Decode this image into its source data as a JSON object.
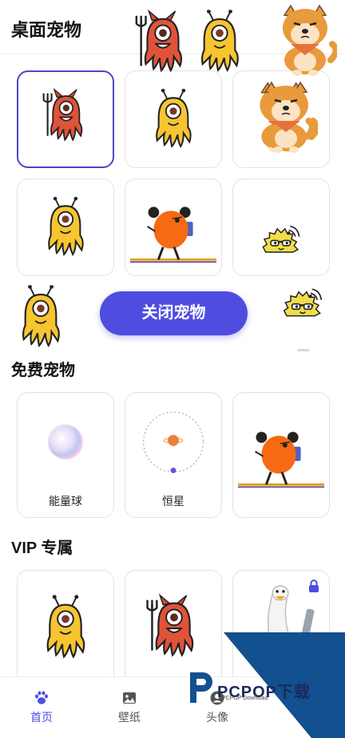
{
  "desktop_pets": {
    "title": "桌面宠物",
    "items": [
      {
        "icon": "devil-octopus",
        "selected": true
      },
      {
        "icon": "yellow-alien-octopus",
        "selected": false
      },
      {
        "icon": "shiba-dog",
        "selected": false
      },
      {
        "icon": "yellow-alien-octopus",
        "selected": false
      },
      {
        "icon": "orange-bean-runner",
        "selected": false
      },
      {
        "icon": "hedgehog-wifi",
        "selected": false
      }
    ]
  },
  "close_pet_button": {
    "label": "关闭宠物"
  },
  "free_pets": {
    "title": "免费宠物",
    "items": [
      {
        "label": "能量球",
        "icon": "energy-orb"
      },
      {
        "label": "恒星",
        "icon": "planet-orbit"
      },
      {
        "label": "",
        "icon": "orange-bean-runner"
      }
    ]
  },
  "vip": {
    "title": "VIP 专属",
    "items": [
      {
        "icon": "yellow-alien-octopus",
        "locked": false
      },
      {
        "icon": "devil-octopus",
        "locked": false
      },
      {
        "icon": "white-goose",
        "locked": true
      }
    ]
  },
  "tabbar": {
    "tabs": [
      {
        "label": "首页",
        "icon": "paw-icon",
        "active": true
      },
      {
        "label": "壁纸",
        "icon": "image-icon",
        "active": false
      },
      {
        "label": "头像",
        "icon": "avatar-icon",
        "active": false
      }
    ]
  },
  "watermark": {
    "text": "PCPOP下载",
    "sub": "PCPOP Download"
  },
  "colors": {
    "accent": "#4f4ce0",
    "selected_border": "#4b48c8"
  }
}
